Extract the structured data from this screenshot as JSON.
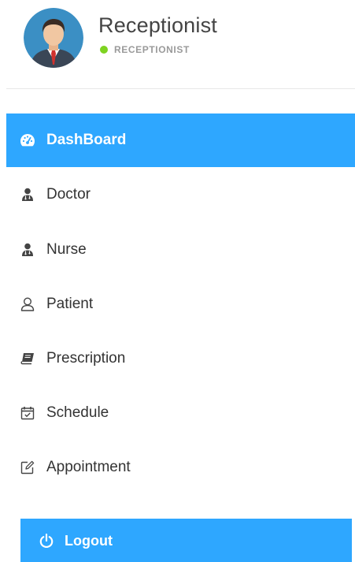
{
  "profile": {
    "name": "Receptionist",
    "role": "RECEPTIONIST",
    "status_color": "#7ed321"
  },
  "menu": {
    "items": [
      {
        "label": "DashBoard",
        "icon": "dashboard-icon",
        "active": true
      },
      {
        "label": "Doctor",
        "icon": "user-md-icon",
        "active": false
      },
      {
        "label": "Nurse",
        "icon": "user-md-icon",
        "active": false
      },
      {
        "label": "Patient",
        "icon": "user-icon",
        "active": false
      },
      {
        "label": "Prescription",
        "icon": "book-icon",
        "active": false
      },
      {
        "label": "Schedule",
        "icon": "calendar-check-icon",
        "active": false
      },
      {
        "label": "Appointment",
        "icon": "edit-icon",
        "active": false
      }
    ]
  },
  "logout": {
    "label": "Logout",
    "icon": "power-icon"
  },
  "colors": {
    "accent": "#2ea7ff",
    "text": "#333333",
    "muted": "#9a9a9a"
  }
}
